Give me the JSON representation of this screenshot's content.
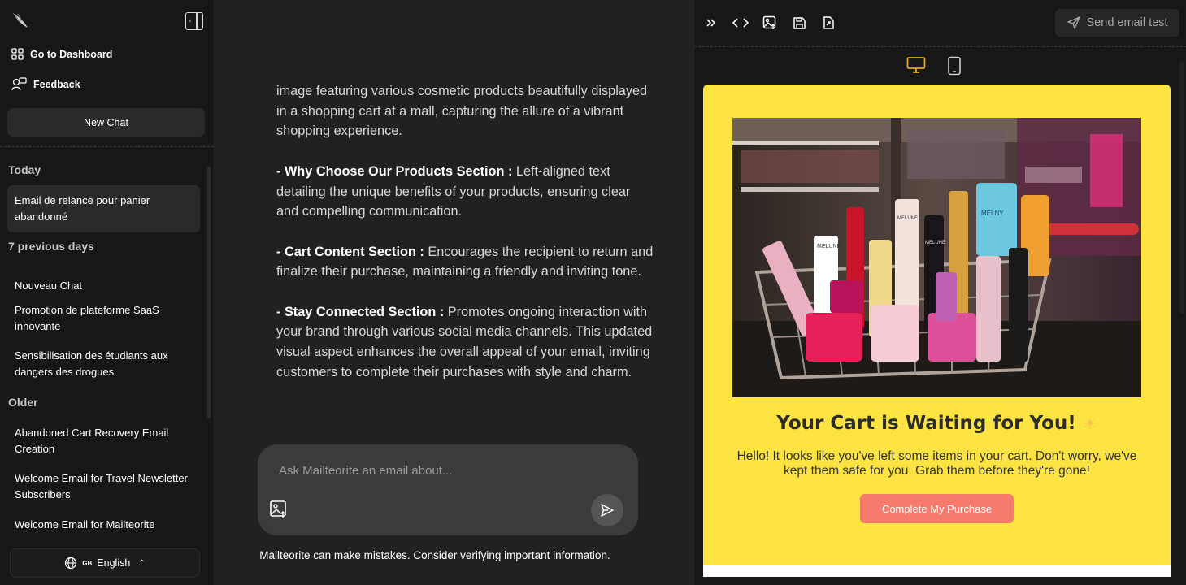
{
  "sidebar": {
    "logo_icon": "feather-logo-icon",
    "collapse_icon": "sidebar-collapse-icon",
    "nav": [
      {
        "label": "Go to Dashboard",
        "icon": "grid-icon"
      },
      {
        "label": "Feedback",
        "icon": "feedback-icon"
      }
    ],
    "new_chat": "New Chat",
    "groups": {
      "today": "Today",
      "previous": "7 previous days",
      "older": "Older"
    },
    "today_items": [
      "Email de relance pour panier abandonné"
    ],
    "previous_items": [
      "Nouveau Chat",
      "Promotion de plateforme SaaS innovante",
      "Sensibilisation des étudiants aux dangers des drogues"
    ],
    "older_items": [
      "Abandoned Cart Recovery Email Creation",
      "Welcome Email for Travel Newsletter Subscribers",
      "Welcome Email for Mailteorite"
    ],
    "language": {
      "flag": "GB",
      "label": "English",
      "icon": "globe-icon"
    }
  },
  "chat": {
    "paragraphs": [
      {
        "bold": "",
        "text": "image featuring various cosmetic products beautifully displayed in a shopping cart at a mall, capturing the allure of a vibrant shopping experience."
      },
      {
        "bold": "- Why Choose Our Products Section :",
        "text": " Left-aligned text detailing the unique benefits of your products, ensuring clear and compelling communication."
      },
      {
        "bold": "- Cart Content Section :",
        "text": " Encourages the recipient to return and finalize their purchase, maintaining a friendly and inviting tone."
      },
      {
        "bold": "- Stay Connected Section :",
        "text": " Promotes ongoing interaction with your brand through various social media channels. This updated visual aspect enhances the overall appeal of your email, inviting customers to complete their purchases with style and charm."
      }
    ],
    "input_placeholder": "Ask Mailteorite an email about...",
    "disclaimer": "Mailteorite can make mistakes. Consider verifying important information."
  },
  "preview": {
    "send_test_label": "Send email test",
    "toolbar_icons": [
      "expand-icon",
      "code-icon",
      "image-icon",
      "save-icon",
      "export-icon"
    ],
    "devices": [
      "desktop-icon",
      "mobile-icon"
    ],
    "active_device_color": "#e0a81a",
    "email": {
      "background": "#fde442",
      "title": "Your Cart is Waiting for You!",
      "title_emoji": "☀",
      "body": "Hello! It looks like you've left some items in your cart. Don't worry, we've kept them safe for you. Grab them before they're gone!",
      "cta": "Complete My Purchase",
      "cta_color": "#f77b6c",
      "product_labels": [
        "MELUNE",
        "MELNY",
        "MELUNE",
        "MELUNE"
      ]
    }
  }
}
